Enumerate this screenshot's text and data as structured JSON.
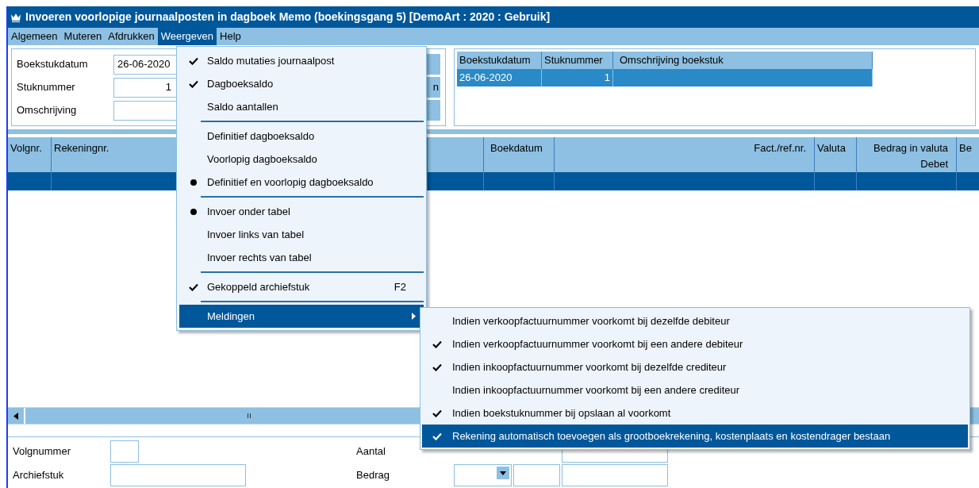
{
  "window": {
    "title": "Invoeren voorlopige journaalposten in dagboek Memo (boekingsgang 5)  [DemoArt : 2020 : Gebruik]"
  },
  "menubar": [
    {
      "label": "Algemeen",
      "selected": false
    },
    {
      "label": "Muteren",
      "selected": false
    },
    {
      "label": "Afdrukken",
      "selected": false
    },
    {
      "label": "Weergeven",
      "selected": true
    },
    {
      "label": "Help",
      "selected": false
    }
  ],
  "header_form": {
    "fields": [
      {
        "label": "Boekstukdatum",
        "value": "26-06-2020"
      },
      {
        "label": "Stuknummer",
        "value": "1"
      },
      {
        "label": "Omschrijving"
      }
    ],
    "button_label": "n"
  },
  "boekstuk_table": {
    "columns": [
      "Boekstukdatum",
      "Stuknummer",
      "Omschrijving boekstuk"
    ],
    "rows": [
      {
        "cells": [
          "26-06-2020",
          "1",
          ""
        ],
        "selected": true
      }
    ]
  },
  "journal_table": {
    "columns": [
      "Volgnr.",
      "Rekeningnr.",
      "Boekdatum",
      "Fact./ref.nr.",
      "Valuta",
      "Bedrag in valuta Debet",
      "Be"
    ]
  },
  "bottom_form": {
    "left": [
      {
        "label": "Volgnummer"
      },
      {
        "label": "Archiefstuk"
      }
    ],
    "right": [
      {
        "label": "Aantal"
      },
      {
        "label": "Bedrag"
      }
    ]
  },
  "view_menu": {
    "items": [
      {
        "kind": "check",
        "label": "Saldo mutaties journaalpost",
        "checked": true
      },
      {
        "kind": "check",
        "label": "Dagboeksaldo",
        "checked": true
      },
      {
        "kind": "check",
        "label": "Saldo aantallen",
        "checked": false
      },
      {
        "kind": "separator"
      },
      {
        "kind": "radio",
        "label": "Definitief dagboeksaldo",
        "checked": false
      },
      {
        "kind": "radio",
        "label": "Voorlopig dagboeksaldo",
        "checked": false
      },
      {
        "kind": "radio",
        "label": "Definitief en voorlopig dagboeksaldo",
        "checked": true
      },
      {
        "kind": "separator"
      },
      {
        "kind": "radio",
        "label": "Invoer onder tabel",
        "checked": true
      },
      {
        "kind": "radio",
        "label": "Invoer links van tabel",
        "checked": false
      },
      {
        "kind": "radio",
        "label": "Invoer rechts van tabel",
        "checked": false
      },
      {
        "kind": "separator"
      },
      {
        "kind": "check",
        "label": "Gekoppeld archiefstuk",
        "checked": true,
        "shortcut": "F2"
      },
      {
        "kind": "separator"
      },
      {
        "kind": "submenu",
        "label": "Meldingen",
        "selected": true
      }
    ]
  },
  "meldingen_menu": {
    "items": [
      {
        "label": "Indien verkoopfactuurnummer voorkomt bij dezelfde debiteur",
        "checked": false,
        "selected": false
      },
      {
        "label": "Indien verkoopfactuurnummer voorkomt bij een andere debiteur",
        "checked": true,
        "selected": false
      },
      {
        "label": "Indien inkoopfactuurnummer voorkomt bij dezelfde crediteur",
        "checked": true,
        "selected": false
      },
      {
        "label": "Indien inkoopfactuurnummer voorkomt bij een andere crediteur",
        "checked": false,
        "selected": false
      },
      {
        "label": "Indien boekstuknummer bij opslaan al voorkomt",
        "checked": true,
        "selected": false
      },
      {
        "label": "Rekening automatisch toevoegen als grootboekrekening, kostenplaats en kostendrager bestaan",
        "checked": true,
        "selected": true
      }
    ]
  }
}
